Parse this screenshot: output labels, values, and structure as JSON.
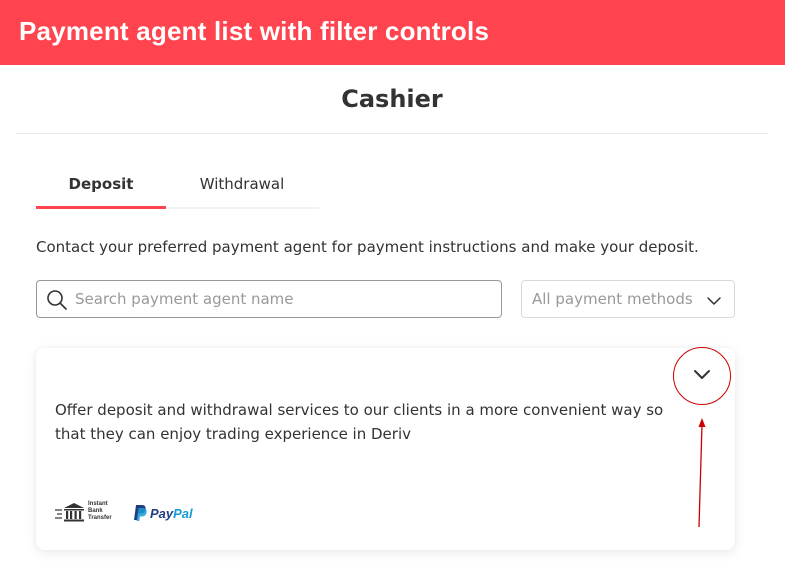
{
  "banner": {
    "title": "Payment agent list with filter controls"
  },
  "page": {
    "title": "Cashier"
  },
  "tabs": [
    {
      "label": "Deposit",
      "active": true
    },
    {
      "label": "Withdrawal",
      "active": false
    }
  ],
  "description": "Contact your preferred payment agent for payment instructions and make your deposit.",
  "search": {
    "placeholder": "Search payment agent name",
    "value": ""
  },
  "payment_method_filter": {
    "selected": "All payment methods"
  },
  "agent_card": {
    "description": "Offer deposit and withdrawal services to our clients in a more convenient way so that they can enjoy trading experience in Deriv",
    "payment_methods": [
      {
        "name": "Instant Bank Transfer",
        "logo_lines": [
          "Instant",
          "Bank",
          "Transfer"
        ],
        "icon": "bank-icon"
      },
      {
        "name": "PayPal",
        "logo_parts": [
          "Pay",
          "Pal"
        ],
        "icon": "paypal-logo"
      }
    ]
  },
  "colors": {
    "accent": "#ff444f",
    "annotation": "#cc0000",
    "text": "#333333",
    "muted": "#999999"
  }
}
